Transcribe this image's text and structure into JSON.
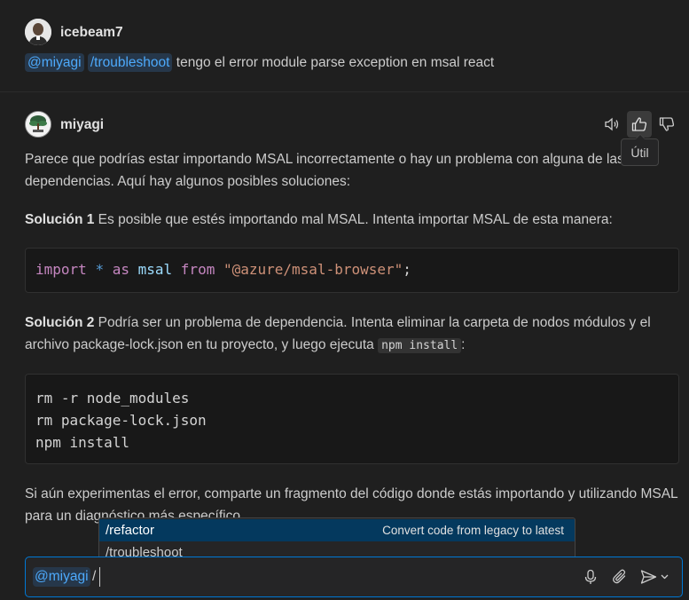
{
  "user_message": {
    "username": "icebeam7",
    "agent_chip": "@miyagi",
    "command_chip": "/troubleshoot",
    "text": " tengo el error module parse exception en msal react"
  },
  "response": {
    "username": "miyagi",
    "tooltip": "Útil",
    "intro": "Parece que podrías estar importando MSAL incorrectamente o hay un problema con alguna de las dependencias. Aquí hay algunos posibles soluciones:",
    "solution1_title": "Solución 1",
    "solution1_text": " Es posible que estés importando mal MSAL. Intenta importar MSAL de esta manera:",
    "code1": {
      "import": "import",
      "star": "*",
      "as": "as",
      "name": "msal",
      "from": "from",
      "module": "\"@azure/msal-browser\"",
      "semicolon": ";"
    },
    "solution2_title": "Solución 2",
    "solution2_text": " Podría ser un problema de dependencia. Intenta eliminar la carpeta de nodos módulos y el archivo package-lock.json en tu proyecto, y luego ejecuta ",
    "solution2_code": "npm install",
    "solution2_end": ":",
    "code2_lines": [
      "rm -r node_modules",
      "rm package-lock.json",
      "npm install"
    ],
    "closing": "Si aún experimentas el error, comparte un fragmento del código donde estás importando y utilizando MSAL para un diagnóstico más específico."
  },
  "suggestions": [
    {
      "label": "/refactor",
      "description": "Convert code from legacy to latest"
    },
    {
      "label": "/troubleshoot",
      "description": ""
    }
  ],
  "input": {
    "agent_chip": "@miyagi",
    "value": "/"
  },
  "icons": {
    "speaker": "speaker-icon",
    "thumbs_up": "thumbs-up-icon",
    "thumbs_down": "thumbs-down-icon",
    "mic": "microphone-icon",
    "attach": "paperclip-icon",
    "send": "send-icon",
    "chevron": "chevron-down-icon"
  },
  "colors": {
    "background": "#1f1f1f",
    "chip_bg": "#26374a",
    "chip_text": "#4daafc",
    "focus_border": "#0078d4",
    "selected_suggestion": "#04395e"
  }
}
